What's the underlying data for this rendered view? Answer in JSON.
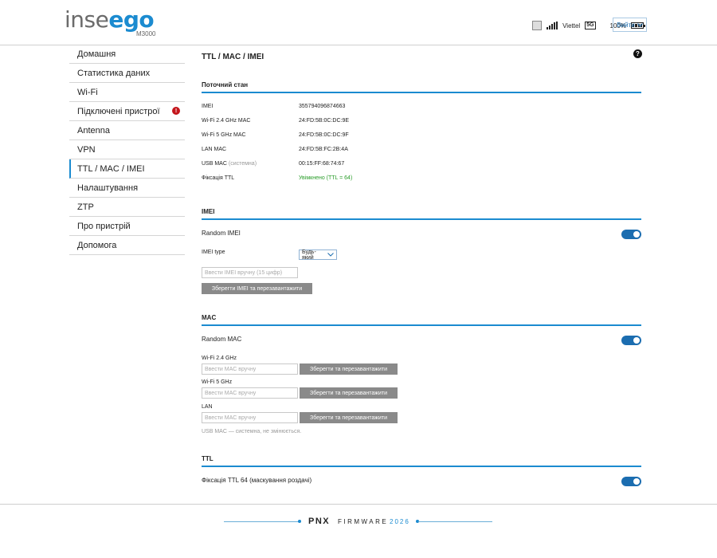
{
  "header": {
    "logo_part1": "inse",
    "logo_part2": "ego",
    "model": "M3000",
    "carrier": "Viettel",
    "network": "5G",
    "battery": "100%",
    "logout_label": "Вийти"
  },
  "sidebar": {
    "items": [
      {
        "label": "Домашня"
      },
      {
        "label": "Статистика даних"
      },
      {
        "label": "Wi-Fi"
      },
      {
        "label": "Підключені пристрої",
        "badge": "!"
      },
      {
        "label": "Antenna"
      },
      {
        "label": "VPN"
      },
      {
        "label": "TTL / MAC / IMEI",
        "active": true
      },
      {
        "label": "Налаштування"
      },
      {
        "label": "ZTP"
      },
      {
        "label": "Про пристрій"
      },
      {
        "label": "Допомога"
      }
    ]
  },
  "main": {
    "title": "TTL / MAC / IMEI",
    "help": "?",
    "status": {
      "heading": "Поточний стан",
      "rows": [
        {
          "key": "IMEI",
          "value": "355794096874663"
        },
        {
          "key": "Wi-Fi 2.4 GHz MAC",
          "value": "24:FD:5B:0C:DC:9E"
        },
        {
          "key": "Wi-Fi 5 GHz MAC",
          "value": "24:FD:5B:0C:DC:9F"
        },
        {
          "key": "LAN MAC",
          "value": "24:FD:5B:FC:2B:4A"
        },
        {
          "key": "USB MAC",
          "key_note": "(системна)",
          "value": "00:15:FF:68:74:67"
        },
        {
          "key": "Фіксація TTL",
          "value": "Увімкнено (TTL = 64)"
        }
      ]
    },
    "imei": {
      "heading": "IMEI",
      "random_label": "Random IMEI",
      "random_on": true,
      "type_label": "IMEI type",
      "type_value": "Будь-який",
      "input_placeholder": "Ввести IMEI вручну (15 цифр)",
      "save_label": "Зберегти IMEI та перезавантажити"
    },
    "mac": {
      "heading": "MAC",
      "random_label": "Random MAC",
      "random_on": true,
      "fields": [
        {
          "label": "Wi-Fi 2.4 GHz",
          "placeholder": "Ввести MAC вручну",
          "button": "Зберегти та перезавантажити"
        },
        {
          "label": "Wi-Fi 5 GHz",
          "placeholder": "Ввести MAC вручну",
          "button": "Зберегти та перезавантажити"
        },
        {
          "label": "LAN",
          "placeholder": "Ввести MAC вручну",
          "button": "Зберегти та перезавантажити"
        }
      ],
      "note": "USB MAC — системна, не змінюється."
    },
    "ttl": {
      "heading": "TTL",
      "fix_label": "Фіксація TTL 64 (маскування роздачі)",
      "fix_on": true
    }
  },
  "footer": {
    "brand": "PNX",
    "firmware": "FIRMWARE",
    "year": "2026"
  },
  "colors": {
    "accent": "#1b8bd0",
    "toggle": "#1b6db0",
    "button": "#8a8a8a",
    "ok": "#2a9d2a",
    "badge": "#c4161c"
  }
}
